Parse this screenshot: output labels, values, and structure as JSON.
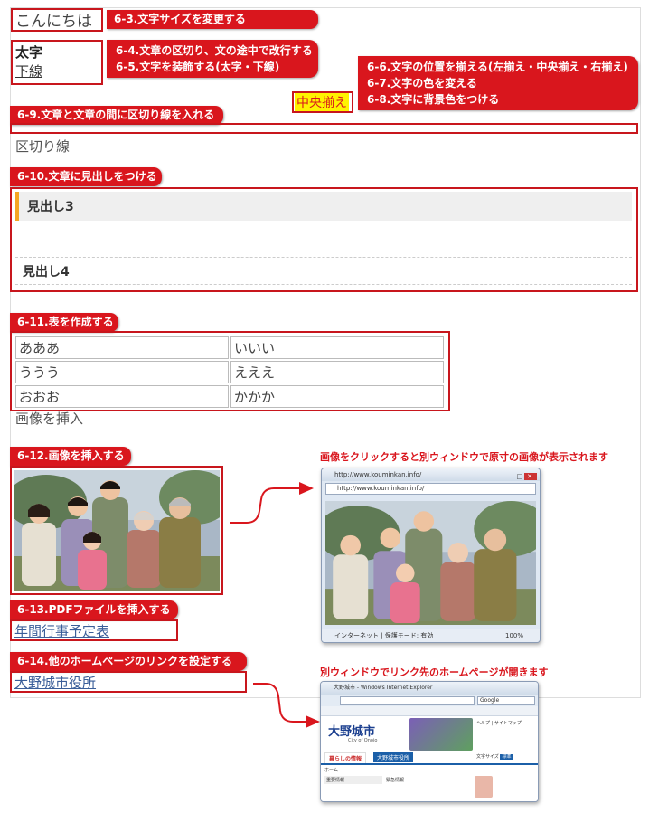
{
  "demo": {
    "greeting": "こんにちは",
    "bold_text": "太字",
    "underline_text": "下線",
    "center_text": "中央揃え",
    "divider_text": "区切り線",
    "heading3": "見出し3",
    "heading4": "見出し4",
    "table_rows": [
      [
        "あああ",
        "いいい"
      ],
      [
        "ううう",
        "えええ"
      ],
      [
        "おおお",
        "かかか"
      ]
    ],
    "image_heading": "画像を挿入",
    "pdf_link": "年間行事予定表",
    "city_link": "大野城市役所"
  },
  "labels": {
    "font_size": "6-3.文字サイズを変更する",
    "line_break": "6-4.文章の区切り、文の途中で改行する",
    "decorate": "6-5.文字を装飾する(太字・下線)",
    "align": "6-6.文字の位置を揃える(左揃え・中央揃え・右揃え)",
    "color": "6-7.文字の色を変える",
    "background": "6-8.文字に背景色をつける",
    "divider": "6-9.文章と文章の間に区切り線を入れる",
    "heading": "6-10.文章に見出しをつける",
    "table": "6-11.表を作成する",
    "image": "6-12.画像を挿入する",
    "pdf": "6-13.PDFファイルを挿入する",
    "link": "6-14.他のホームページのリンクを設定する"
  },
  "captions": {
    "image_popup": "画像をクリックすると別ウィンドウで原寸の画像が表示されます",
    "link_popup": "別ウィンドウでリンク先のホームページが開きます"
  },
  "image_window": {
    "title_url": "http://www.kouminkan.info/",
    "address_url": "http://www.kouminkan.info/",
    "status_zone": "インターネット | 保護モード: 有効",
    "zoom": "100%"
  },
  "city_window": {
    "title": "大野城市 - Windows Internet Explorer",
    "search_box": "Google",
    "logo_name": "大野城市",
    "logo_sub": "City of Onojo",
    "tab_life": "暮らしの情報",
    "tab_office": "大野城市役所",
    "nav_home": "ホーム",
    "menu_1": "重要情報",
    "menu_2": "緊急情報",
    "font_size_label": "文字サイズ",
    "font_size_std": "標準"
  },
  "colors": {
    "accent_red": "#d9161d",
    "link_blue": "#3a5e99",
    "highlight_yellow": "#fff200"
  }
}
